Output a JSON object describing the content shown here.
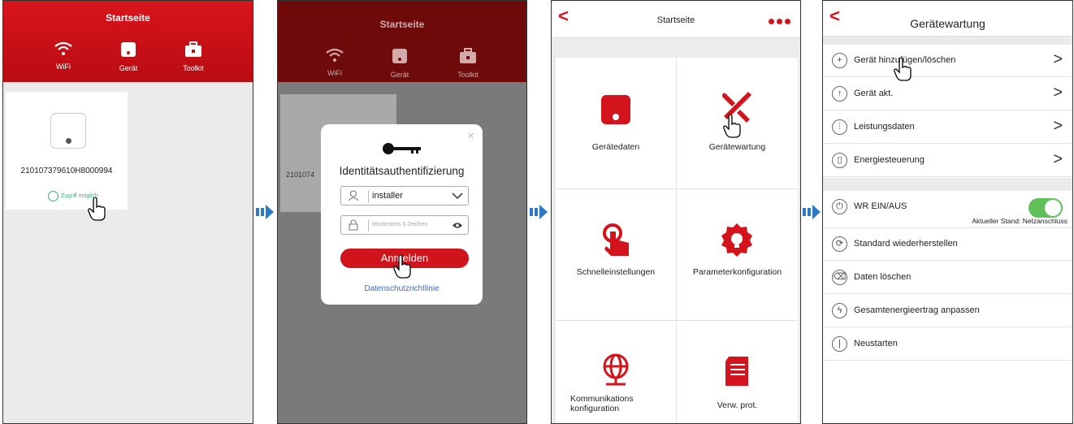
{
  "screen1": {
    "title": "Startseite",
    "tabs": [
      "WiFi",
      "Gerät",
      "Toolkit"
    ],
    "device_id": "210107379610H8000994",
    "status": "Zugriff möglich"
  },
  "screen2": {
    "title": "Startseite",
    "tabs": [
      "WiFi",
      "Gerät",
      "Toolkit"
    ],
    "device_id_partial": "2101074",
    "dialog": {
      "close": "×",
      "title": "Identitätsauthentifizierung",
      "user_value": "installer",
      "password_placeholder": "Mindestens 6 Zeichen",
      "login_button": "Anmelden",
      "privacy_link": "Datenschutzrichtlinie"
    }
  },
  "screen3": {
    "back": "<",
    "title": "Startseite",
    "items": [
      "Gerätedaten",
      "Gerätewartung",
      "Schnelleinstellungen",
      "Parameterkonfiguration",
      "Kommunikations\nkonfiguration",
      "Verw. prot."
    ]
  },
  "screen4": {
    "back": "<",
    "title": "Gerätewartung",
    "group1": [
      "Gerät hinzufügen/löschen",
      "Gerät akt.",
      "Leistungsdaten",
      "Energiesteuerung"
    ],
    "toggle_label": "WR EIN/AUS",
    "toggle_status": "Aktueller Stand: Netzanschluss",
    "group2": [
      "Standard wiederherstellen",
      "Daten löschen",
      "Gesamtenergieertrag anpassen",
      "Neustarten"
    ]
  },
  "colors": {
    "brand_red": "#d4141c",
    "toggle_green": "#60c05a",
    "link_blue": "#3b6cc4",
    "status_green": "#2bb37f"
  }
}
